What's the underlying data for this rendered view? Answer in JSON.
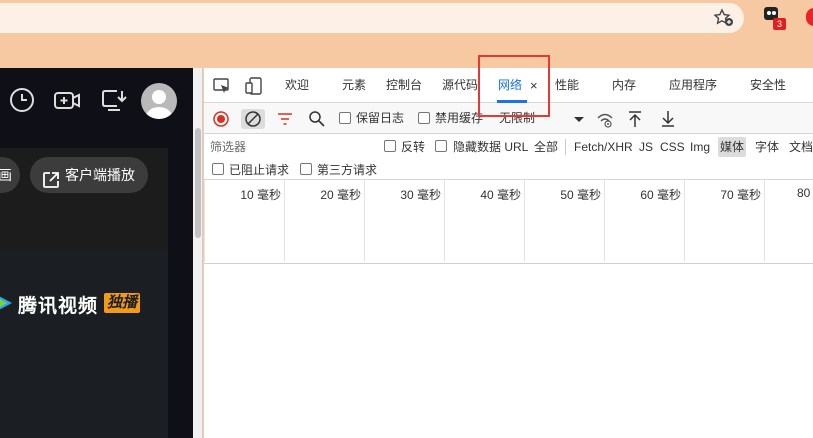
{
  "browser": {
    "extension_badge": "3",
    "icons": [
      "star-add-icon",
      "extension-icon",
      "profile-icon"
    ]
  },
  "page": {
    "pill_left_label": "画",
    "client_play_label": "客户端播放",
    "brand_text": "腾讯视频",
    "brand_tag": "独播"
  },
  "devtools": {
    "tabs": [
      {
        "label": "欢迎"
      },
      {
        "label": "元素"
      },
      {
        "label": "控制台"
      },
      {
        "label": "源代码"
      },
      {
        "label": "网络",
        "active": true
      },
      {
        "label": "性能"
      },
      {
        "label": "内存"
      },
      {
        "label": "应用程序"
      },
      {
        "label": "安全性"
      }
    ],
    "tab_close": "×",
    "toolbar": {
      "preserve_log": "保留日志",
      "disable_cache": "禁用缓存",
      "throttle": "无限制"
    },
    "filter": {
      "placeholder": "筛选器",
      "invert": "反转",
      "hide_data_url": "隐藏数据 URL",
      "types": [
        "全部",
        "Fetch/XHR",
        "JS",
        "CSS",
        "Img",
        "媒体",
        "字体",
        "文档"
      ],
      "selected_type": "媒体",
      "blocked_requests": "已阻止请求",
      "third_party": "第三方请求"
    },
    "timeline_ticks": [
      "10 毫秒",
      "20 毫秒",
      "30 毫秒",
      "40 毫秒",
      "50 毫秒",
      "60 毫秒",
      "70 毫秒",
      "80"
    ],
    "colors": {
      "accent": "#1a73e8",
      "record": "#d93025",
      "highlight": "#e53935"
    }
  }
}
